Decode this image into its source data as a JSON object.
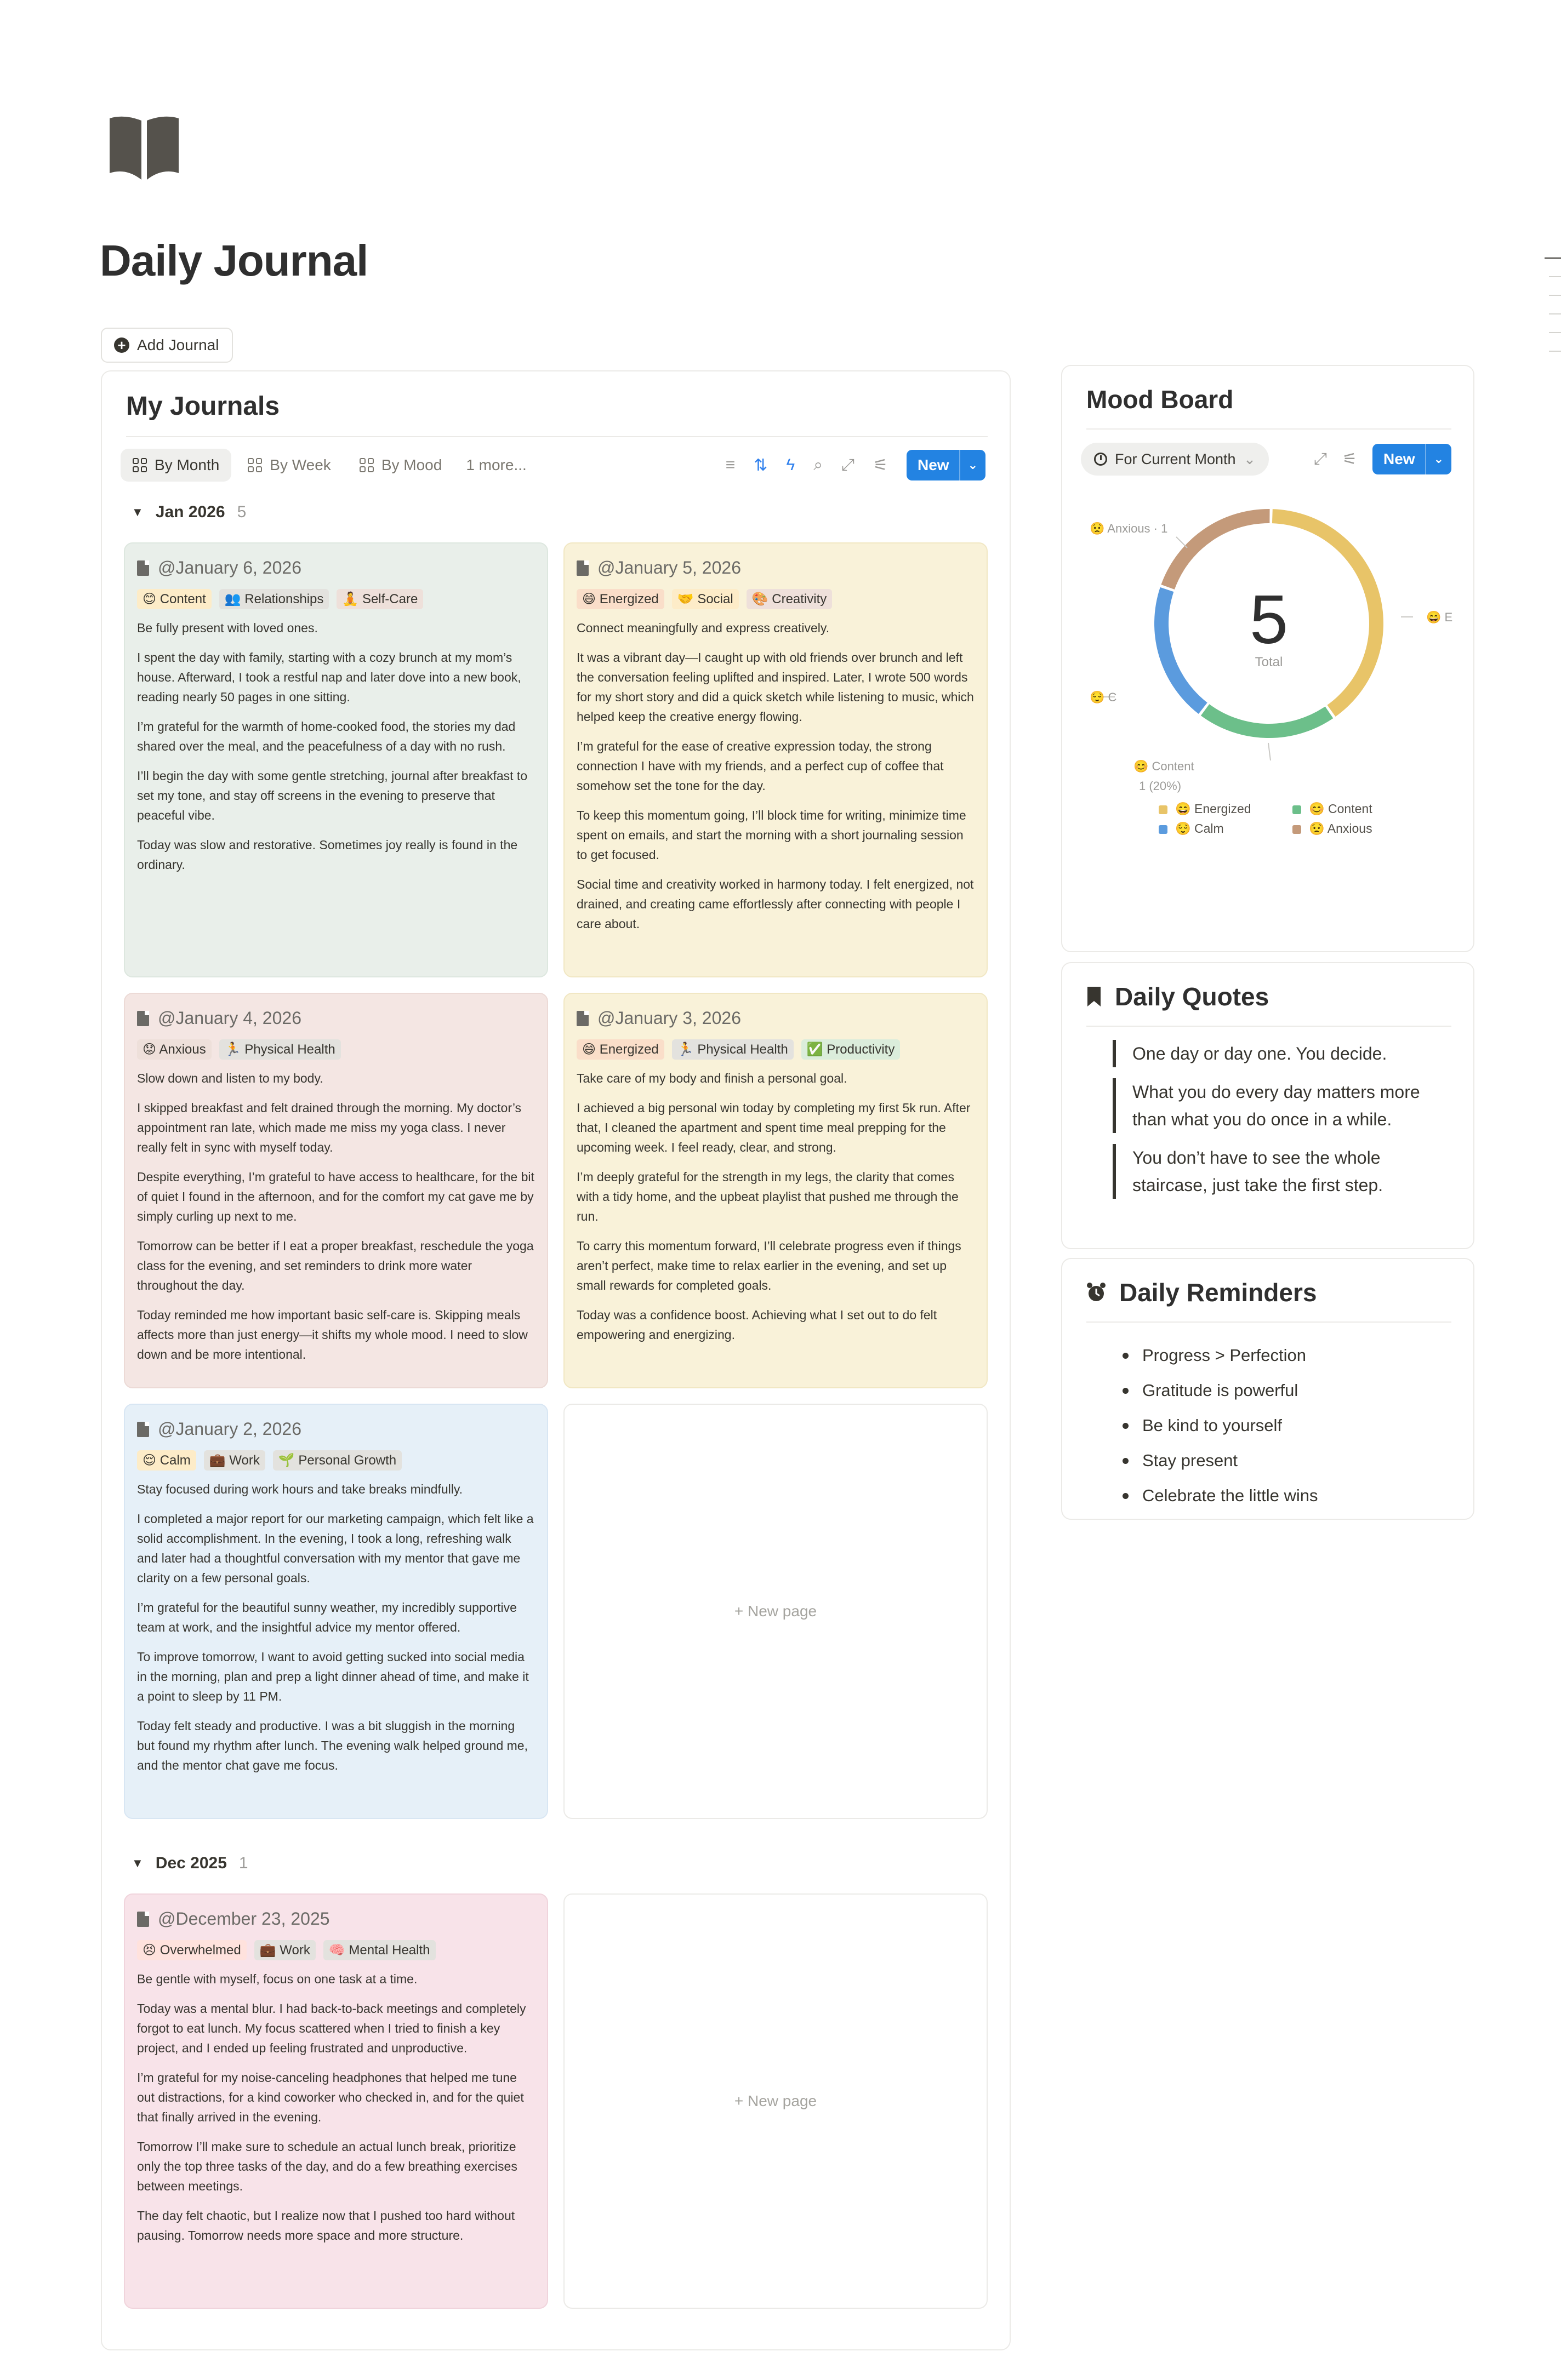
{
  "page": {
    "title": "Daily Journal",
    "add_button": "Add Journal"
  },
  "journals": {
    "title": "My Journals",
    "views": [
      {
        "label": "By Month",
        "active": true
      },
      {
        "label": "By Week",
        "active": false
      },
      {
        "label": "By Mood",
        "active": false
      }
    ],
    "more_views": "1 more...",
    "tool_icons": [
      "filter-icon",
      "sort-icon",
      "lightning-icon",
      "search-icon",
      "expand-icon",
      "settings-icon"
    ],
    "new_label": "New",
    "groups": [
      {
        "label": "Jan 2026",
        "count": "5"
      },
      {
        "label": "Dec 2025",
        "count": "1"
      }
    ],
    "new_page_label": "New page",
    "entries": [
      {
        "date": "@January 6, 2026",
        "tags": [
          "😊 Content",
          "👥 Relationships",
          "🧘 Self-Care"
        ],
        "paragraphs": [
          "Be fully present with loved ones.",
          "I spent the day with family, starting with a cozy brunch at my mom’s house. Afterward, I took a restful nap and later dove into a new book, reading nearly 50 pages in one sitting.",
          "I’m grateful for the warmth of home-cooked food, the stories my dad shared over the meal, and the peacefulness of a day with no rush.",
          "I’ll begin the day with some gentle stretching, journal after breakfast to set my tone, and stay off screens in the evening to preserve that peaceful vibe.",
          "Today was slow and restorative. Sometimes joy really is found in the ordinary."
        ]
      },
      {
        "date": "@January 5, 2026",
        "tags": [
          "😄 Energized",
          "🤝 Social",
          "🎨 Creativity"
        ],
        "paragraphs": [
          "Connect meaningfully and express creatively.",
          "It was a vibrant day—I caught up with old friends over brunch and left the conversation feeling uplifted and inspired. Later, I wrote 500 words for my short story and did a quick sketch while listening to music, which helped keep the creative energy flowing.",
          "I’m grateful for the ease of creative expression today, the strong connection I have with my friends, and a perfect cup of coffee that somehow set the tone for the day.",
          "To keep this momentum going, I’ll block time for writing, minimize time spent on emails, and start the morning with a short journaling session to get focused.",
          "Social time and creativity worked in harmony today. I felt energized, not drained, and creating came effortlessly after connecting with people I care about."
        ]
      },
      {
        "date": "@January 4, 2026",
        "tags": [
          "😟 Anxious",
          "🏃 Physical Health"
        ],
        "paragraphs": [
          "Slow down and listen to my body.",
          "I skipped breakfast and felt drained through the morning. My doctor’s appointment ran late, which made me miss my yoga class. I never really felt in sync with myself today.",
          "Despite everything, I’m grateful to have access to healthcare, for the bit of quiet I found in the afternoon, and for the comfort my cat gave me by simply curling up next to me.",
          "Tomorrow can be better if I eat a proper breakfast, reschedule the yoga class for the evening, and set reminders to drink more water throughout the day.",
          "Today reminded me how important basic self-care is. Skipping meals affects more than just energy—it shifts my whole mood. I need to slow down and be more intentional."
        ]
      },
      {
        "date": "@January 3, 2026",
        "tags": [
          "😄 Energized",
          "🏃 Physical Health",
          "✅ Productivity"
        ],
        "paragraphs": [
          "Take care of my body and finish a personal goal.",
          "I achieved a big personal win today by completing my first 5k run. After that, I cleaned the apartment and spent time meal prepping for the upcoming week. I feel ready, clear, and strong.",
          "I’m deeply grateful for the strength in my legs, the clarity that comes with a tidy home, and the upbeat playlist that pushed me through the run.",
          "To carry this momentum forward, I’ll celebrate progress even if things aren’t perfect, make time to relax earlier in the evening, and set up small rewards for completed goals.",
          "Today was a confidence boost. Achieving what I set out to do felt empowering and energizing."
        ]
      },
      {
        "date": "@January 2, 2026",
        "tags": [
          "😌 Calm",
          "💼 Work",
          "🌱 Personal Growth"
        ],
        "paragraphs": [
          "Stay focused during work hours and take breaks mindfully.",
          "I completed a major report for our marketing campaign, which felt like a solid accomplishment. In the evening, I took a long, refreshing walk and later had a thoughtful conversation with my mentor that gave me clarity on a few personal goals.",
          "I’m grateful for the beautiful sunny weather, my incredibly supportive team at work, and the insightful advice my mentor offered.",
          "To improve tomorrow, I want to avoid getting sucked into social media in the morning, plan and prep a light dinner ahead of time, and make it a point to sleep by 11 PM.",
          "Today felt steady and productive. I was a bit sluggish in the morning but found my rhythm after lunch. The evening walk helped ground me, and the mentor chat gave me focus."
        ]
      },
      {
        "date": "@December 23, 2025",
        "tags": [
          "😣 Overwhelmed",
          "💼 Work",
          "🧠 Mental Health"
        ],
        "paragraphs": [
          "Be gentle with myself, focus on one task at a time.",
          "Today was a mental blur. I had back-to-back meetings and completely forgot to eat lunch. My focus scattered when I tried to finish a key project, and I ended up feeling frustrated and unproductive.",
          "I’m grateful for my noise-canceling headphones that helped me tune out distractions, for a kind coworker who checked in, and for the quiet that finally arrived in the evening.",
          "Tomorrow I’ll make sure to schedule an actual lunch break, prioritize only the top three tasks of the day, and do a few breathing exercises between meetings.",
          "The day felt chaotic, but I realize now that I pushed too hard without pausing. Tomorrow needs more space and more structure."
        ]
      }
    ]
  },
  "mood_board": {
    "title": "Mood Board",
    "filter_label": "For Current Month",
    "new_label": "New",
    "total_label": "Total",
    "callouts": {
      "anxious": "😟 Anxious · 1",
      "energized": "😄 E",
      "calm": "😌 C",
      "content_name": "😊 Content",
      "content_value": "1 (20%)"
    },
    "legend": [
      {
        "label": "😄 Energized",
        "color": "#e8c468"
      },
      {
        "label": "😊 Content",
        "color": "#6cbf8a"
      },
      {
        "label": "😌 Calm",
        "color": "#5b9bde"
      },
      {
        "label": "😟 Anxious",
        "color": "#c49a7a"
      }
    ]
  },
  "chart_data": {
    "type": "pie",
    "donut": true,
    "center_value": "5",
    "center_label": "Total",
    "categories": [
      "😄 Energized",
      "😊 Content",
      "😌 Calm",
      "😟 Anxious"
    ],
    "values": [
      2,
      1,
      1,
      1
    ],
    "colors": [
      "#e8c468",
      "#6cbf8a",
      "#5b9bde",
      "#c49a7a"
    ],
    "legend_position": "bottom"
  },
  "quotes": {
    "title": "Daily Quotes",
    "items": [
      "One day or day one. You decide.",
      "What you do every day matters more than what you do once in a while.",
      "You don’t have to see the whole staircase, just take the first step."
    ]
  },
  "reminders": {
    "title": "Daily Reminders",
    "items": [
      "Progress > Perfection",
      "Gratitude is powerful",
      "Be kind to yourself",
      "Stay present",
      "Celebrate the little wins"
    ]
  }
}
